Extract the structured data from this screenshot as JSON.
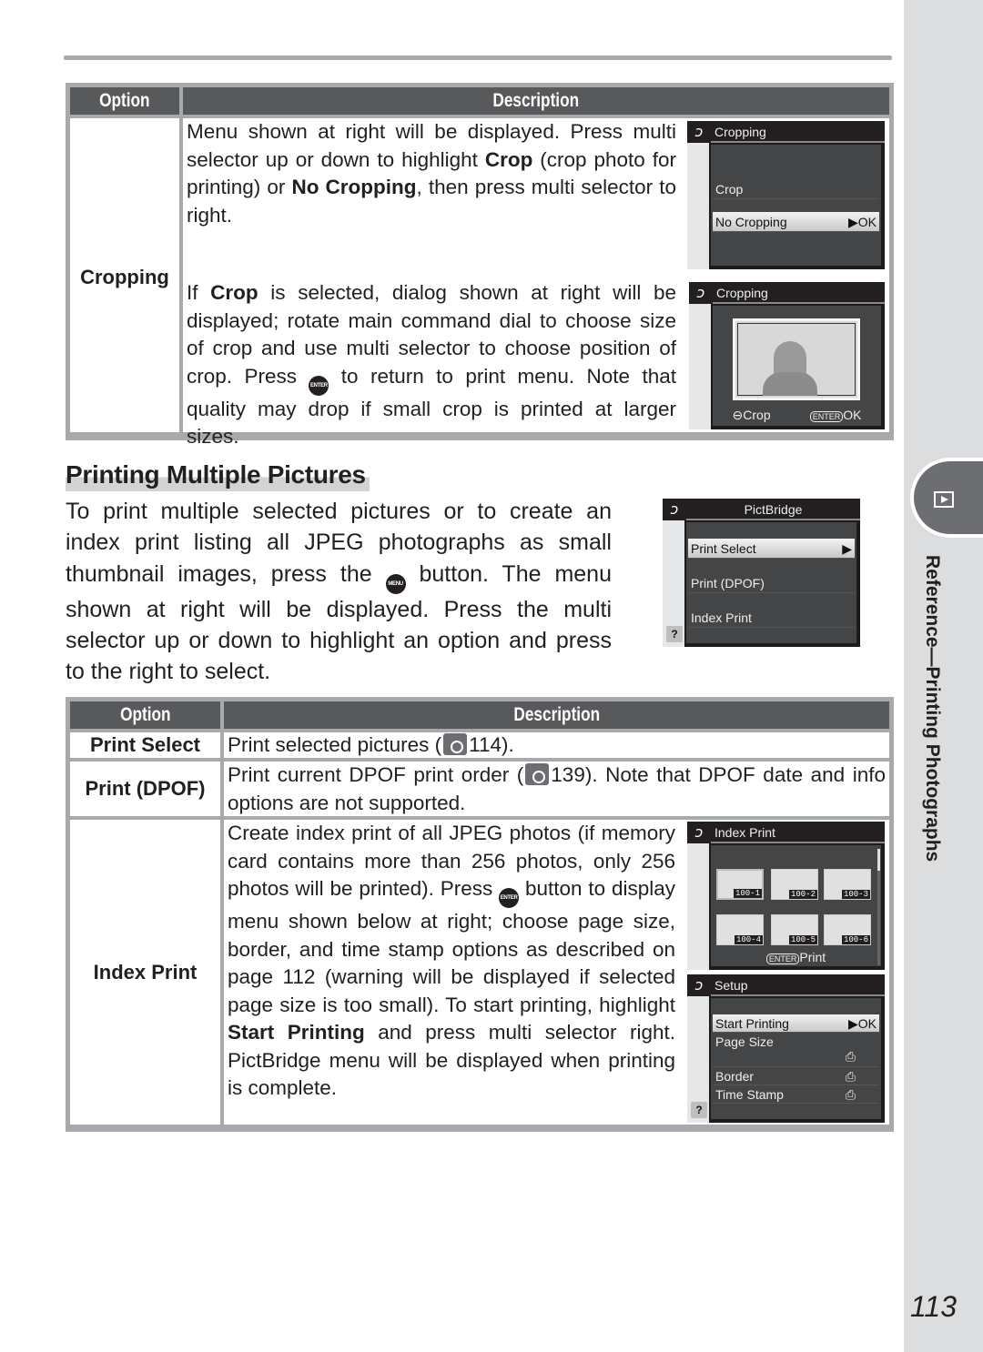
{
  "table1": {
    "header": {
      "option": "Option",
      "description": "Description"
    },
    "row": {
      "option": "Cropping",
      "desc1": {
        "t1": "Menu shown at right will be displayed.  Press multi selector up or down to  highlight ",
        "b1": "Crop",
        "t2": " (crop photo for printing) or ",
        "b2": "No Cropping",
        "t3": ", then press multi selector to right."
      },
      "desc2": {
        "t1": "If ",
        "b1": "Crop",
        "t2": " is selected, dialog shown at right will be displayed; rotate main command dial to choose size of crop and use multi selector to choose position of crop.  Press ",
        "icon": "ENTER",
        "t3": " to return to print menu.  Note that quality may drop if small crop is printed at larger sizes."
      }
    }
  },
  "screens": {
    "crop_menu": {
      "title": "Cropping",
      "items": [
        "Crop",
        "No Cropping"
      ],
      "selected_suffix": "▶OK"
    },
    "crop_dialog": {
      "title": "Cropping",
      "footer_left": "Crop",
      "footer_right": "OK",
      "enter_label": "ENTER"
    },
    "pictbridge": {
      "title": "PictBridge",
      "items": [
        "Print Select",
        "Print (DPOF)",
        "Index Print"
      ],
      "selected_suffix": "▶",
      "help": "?"
    },
    "index_print": {
      "title": "Index Print",
      "thumbs": [
        "100-1",
        "100-2",
        "100-3",
        "100-4",
        "100-5",
        "100-6"
      ],
      "footer": "Print",
      "enter_label": "ENTER"
    },
    "setup": {
      "title": "Setup",
      "items": [
        "Start Printing",
        "Page Size",
        "Border",
        "Time Stamp"
      ],
      "selected_suffix": "▶OK",
      "help": "?"
    }
  },
  "section": {
    "title": "Printing Multiple Pictures",
    "intro": {
      "t1": "To print multiple selected pictures or to create an index print listing all JPEG photographs as small thumbnail images, press the ",
      "icon": "MENU",
      "t2": " button.  The menu shown at right will be displayed.  Press the multi selector up or down to highlight an option and press to the right to select."
    }
  },
  "table2": {
    "header": {
      "option": "Option",
      "description": "Description"
    },
    "rows": [
      {
        "option": "Print Select",
        "t1": "Print selected pictures (",
        "ref": "114",
        "t2": ")."
      },
      {
        "option": "Print (DPOF)",
        "t1": "Print current DPOF print order (",
        "ref": "139",
        "t2": ").  Note that DPOF date and info options are not supported."
      },
      {
        "option": "Index Print",
        "t1": "Create index print of all JPEG photos (if memory card contains more than 256 photos, only 256 photos will be printed).  Press ",
        "icon": "ENTER",
        "t2": " button to display menu shown below at right; choose page size, border, and time stamp options as described on page 112 (warning will be displayed if selected page size is too small).  To start printing, highlight ",
        "b1": "Start Printing",
        "t3": " and press multi selector right.  PictBridge menu will be displayed when printing is complete."
      }
    ]
  },
  "sidebar": {
    "tab_icon": "playback-icon",
    "label": "Reference—Printing Photographs"
  },
  "page_number": "113"
}
